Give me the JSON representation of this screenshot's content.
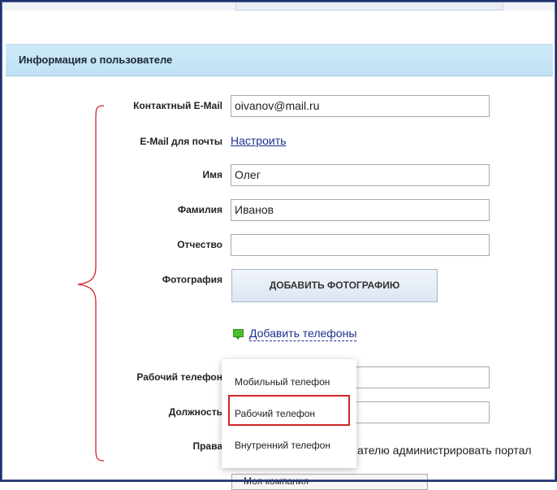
{
  "section": {
    "title": "Информация о пользователе"
  },
  "fields": {
    "email": {
      "label": "Контактный E-Mail",
      "value": "oivanov@mail.ru"
    },
    "mail_email": {
      "label": "E-Mail для почты",
      "link": "Настроить"
    },
    "first_name": {
      "label": "Имя",
      "value": "Олег"
    },
    "last_name": {
      "label": "Фамилия",
      "value": "Иванов"
    },
    "middle_name": {
      "label": "Отчество",
      "value": ""
    },
    "photo": {
      "label": "Фотография",
      "button": "ДОБАВИТЬ ФОТОГРАФИЮ"
    },
    "work_phone": {
      "label": "Рабочий телефон",
      "value": ""
    },
    "position": {
      "label": "Должность",
      "value": ""
    },
    "rights": {
      "label": "Права",
      "text": "ателю администрировать портал"
    },
    "company": {
      "value": "Моя компания"
    }
  },
  "add_phones": {
    "label": "Добавить телефоны",
    "icon": "phone-icon"
  },
  "phone_menu": {
    "items": [
      "Мобильный телефон",
      "Рабочий телефон",
      "Внутренний телефон"
    ],
    "highlighted": "Рабочий телефон"
  },
  "colors": {
    "header_bg": "#c6e5f6",
    "link": "#1b2f8c",
    "highlight_border": "#d12525",
    "brace": "#d12525"
  }
}
